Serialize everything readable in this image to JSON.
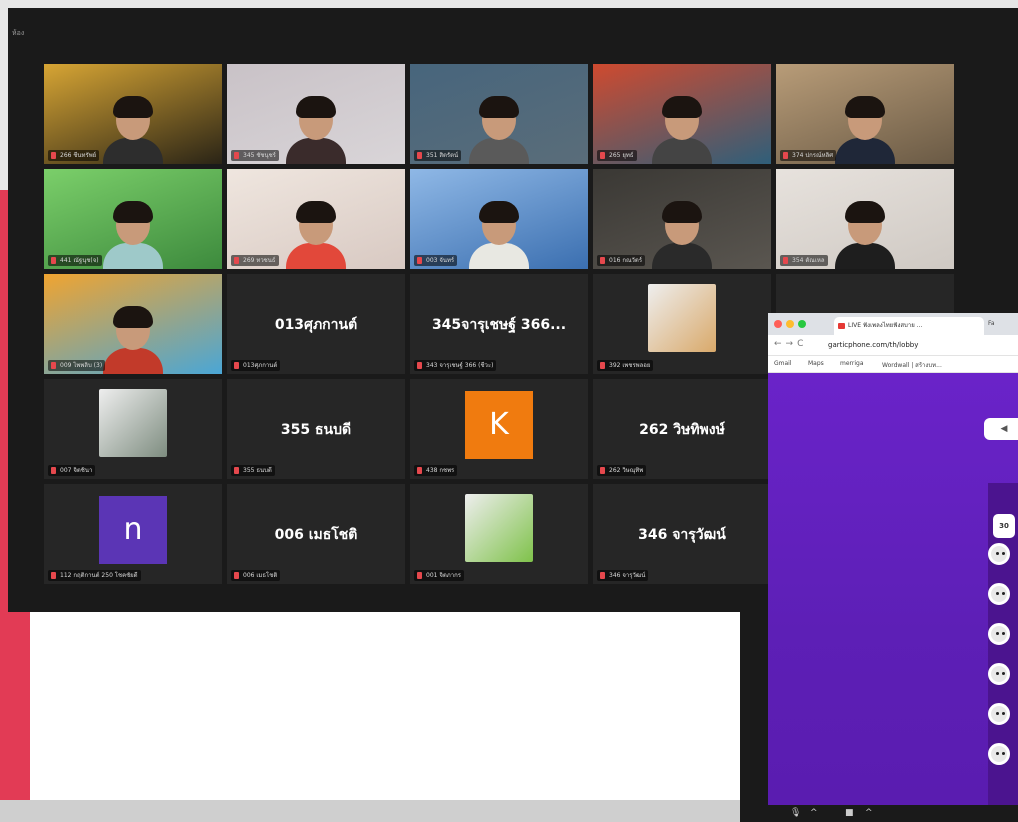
{
  "zoom": {
    "top_text": "ห้อง",
    "participants": [
      {
        "label": "266 ชีนทรัพย์",
        "type": "video",
        "bg": "#2a2416",
        "scene": "#d7a534",
        "shirt": "#2d2d2d"
      },
      {
        "label": "345 ชัชนุชร์",
        "type": "video",
        "bg": "#d9d5d8",
        "scene": "#c9c2c7",
        "shirt": "#3a2b2b"
      },
      {
        "label": "351 สิตรัตน์",
        "type": "video",
        "bg": "#5a6d7a",
        "scene": "#47657c",
        "shirt": "#5a5a5a"
      },
      {
        "label": "265 ยุทธ์",
        "type": "video",
        "bg": "#2f5f7a",
        "scene": "#cf4a2f",
        "shirt": "#444"
      },
      {
        "label": "374 ปกรณ์หลิศ",
        "type": "video",
        "bg": "#6a5a45",
        "scene": "#b89c78",
        "shirt": "#1f2738"
      },
      {
        "label": "441 ณัฐนุช(จ)",
        "type": "video",
        "bg": "#3d8a3d",
        "scene": "#7bcf6a",
        "shirt": "#9ec9c9"
      },
      {
        "label": "269 ทวชนธ์",
        "type": "video",
        "bg": "#d8c9c2",
        "scene": "#efe6df",
        "shirt": "#e2483a"
      },
      {
        "label": "003 จันทร์",
        "type": "video",
        "bg": "#3b6fb0",
        "scene": "#8fb8e6",
        "shirt": "#e8e8e2",
        "active": true
      },
      {
        "label": "016 กณวัตร์",
        "type": "video",
        "bg": "#5a5650",
        "scene": "#3a3834",
        "shirt": "#2a2a2a"
      },
      {
        "label": "354 ตัณเหล",
        "type": "video",
        "bg": "#cfc9c3",
        "scene": "#e7e2dd",
        "shirt": "#1e1e1e"
      },
      {
        "label": "009 ไพพลิบ (3)",
        "type": "video",
        "bg": "#4aa6d6",
        "scene": "#f0a430",
        "shirt": "#c23a2a"
      },
      {
        "label": "013ศุภกานต์",
        "type": "name",
        "name": "013ศุภกานต์"
      },
      {
        "label": "343 จารุเชษฐ์ 366 (ชีวะ)",
        "type": "name",
        "name": "345จารุเชษฐ์ 366..."
      },
      {
        "label": "392 เพชรพลอย",
        "type": "thumb",
        "thumb": "#d9a96a"
      },
      {
        "label": "",
        "type": "empty"
      },
      {
        "label": "007 จิตชินา",
        "type": "thumb",
        "thumb": "#7e8d80"
      },
      {
        "label": "355 ธนบดี",
        "type": "name",
        "name": "355 ธนบดี"
      },
      {
        "label": "438 กชพร",
        "type": "avatar",
        "letter": "K",
        "color": "#f07b0f"
      },
      {
        "label": "262 วิษณุทิพ",
        "type": "name",
        "name": "262 วิษทิพงษ์"
      },
      {
        "label": "",
        "type": "empty"
      },
      {
        "label": "112 กฤติกานต์ 250 โชคชัยดี",
        "type": "avatar",
        "letter": "n",
        "color": "#5b35b5"
      },
      {
        "label": "006 เมธโชติ",
        "type": "name",
        "name": "006 เมธโชติ"
      },
      {
        "label": "001 จิตภากร",
        "type": "thumb",
        "thumb": "#7fc24a"
      },
      {
        "label": "346 จารุวัฒน์",
        "type": "name",
        "name": "346 จารุวัฒน์"
      },
      {
        "label": "",
        "type": "empty"
      }
    ]
  },
  "browser": {
    "tab_title": "LIVE ฟังเพลงไทยฟังสบาย ...",
    "tab2": "Fa",
    "url": "garticphone.com/th/lobby",
    "bookmarks": [
      "Gmail",
      "Maps",
      "merriga",
      "Wordwall | สร้างบท..."
    ],
    "back_label": "◀",
    "player_count": "30",
    "dot_colors": [
      "#ff5f57",
      "#febc2e",
      "#28c840"
    ]
  },
  "colors": {
    "accent": "#b8e06b",
    "gartic_purple": "#6a23c9"
  }
}
